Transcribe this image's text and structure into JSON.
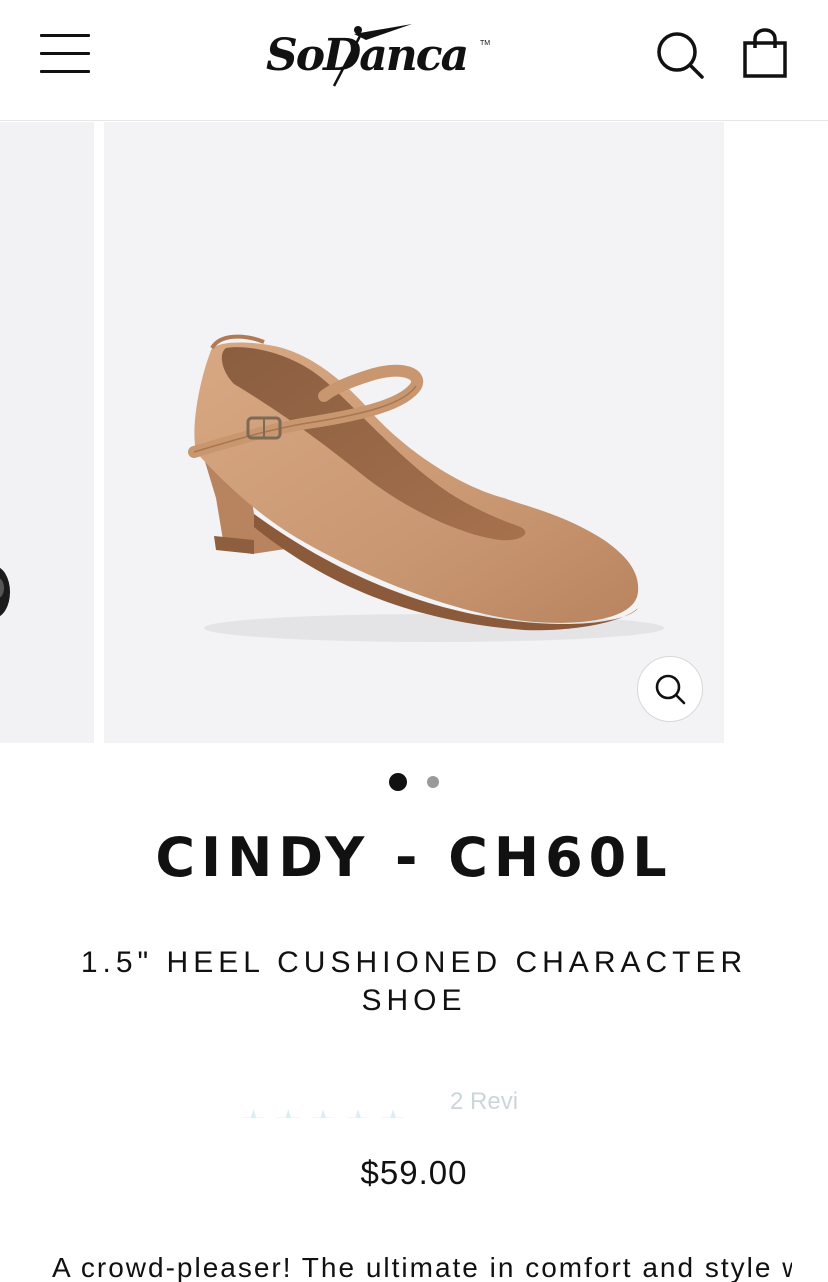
{
  "header": {
    "logo_text": "SoDanca",
    "logo_tm": "TM",
    "menu_icon": "hamburger-icon",
    "search_icon": "search-icon",
    "cart_icon": "shopping-bag-icon"
  },
  "gallery": {
    "active_slide": 1,
    "slide_count": 2,
    "zoom_icon": "zoom-icon"
  },
  "product": {
    "title": "CINDY - CH60L",
    "subtitle": "1.5\" HEEL CUSHIONED CHARACTER SHOE",
    "reviews_stars": "★★★★★",
    "reviews_text": "2 Revi",
    "price": "$59.00",
    "description_preview": "A crowd-pleaser! The ultimate in comfort and style with So"
  },
  "colors": {
    "shoe": "#c99873",
    "background": "#f3f3f5",
    "text": "#111111"
  }
}
